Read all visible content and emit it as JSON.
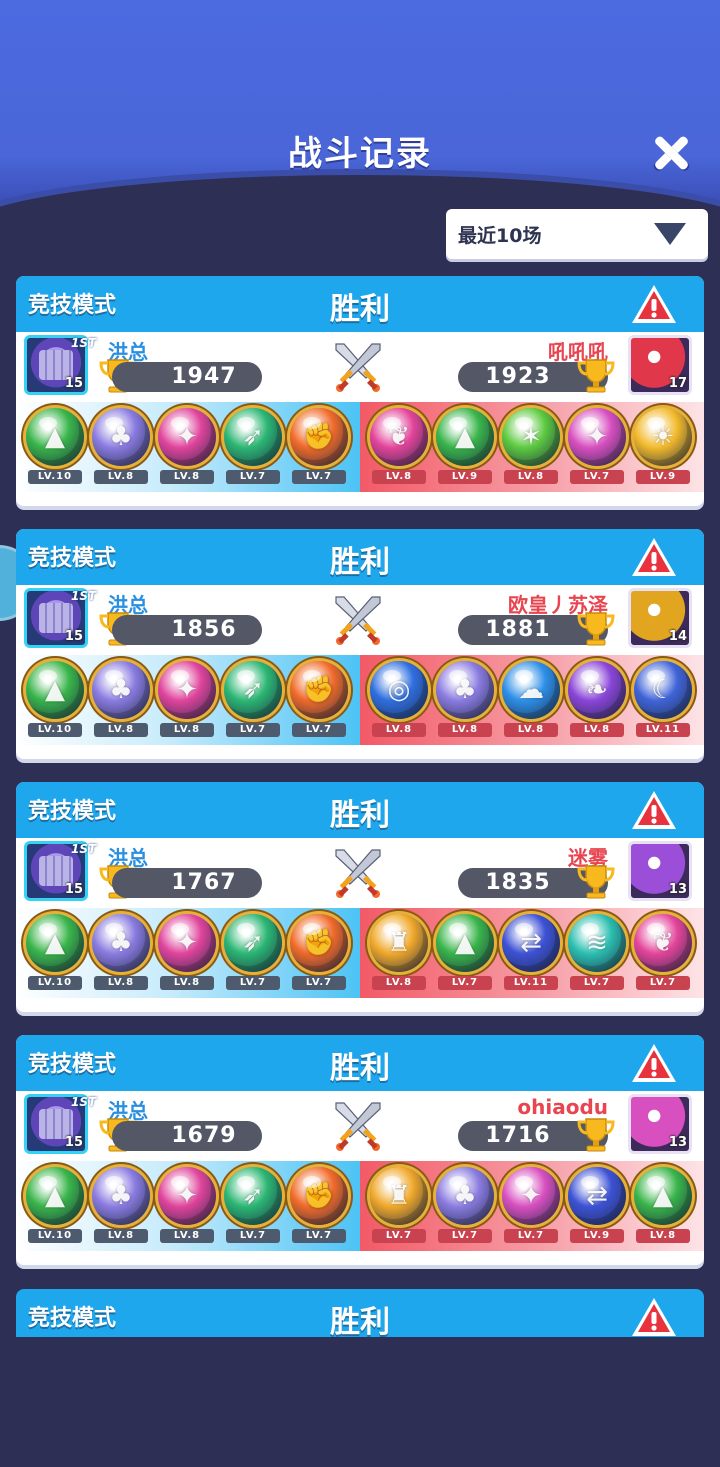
{
  "header": {
    "title": "战斗记录"
  },
  "filter": {
    "label": "最近10场"
  },
  "colors": {
    "accent": "#1ea7ec",
    "win_text": "#ffffff",
    "me_name": "#2a8fe0",
    "opp_name": "#e84550"
  },
  "me": {
    "name": "洪总",
    "level": "15",
    "rank_badge": "1ST"
  },
  "records": [
    {
      "mode": "竞技模式",
      "result": "胜利",
      "me_score": "1947",
      "opp": {
        "name": "吼吼吼",
        "score": "1923",
        "level": "17",
        "avatar_color": "#e0384a"
      },
      "me_orbs": [
        {
          "icon": "arrow-up-icon",
          "lv": "LV.10",
          "color": "#39b54a"
        },
        {
          "icon": "crowd-icon",
          "lv": "LV.8",
          "color": "#8a7be0"
        },
        {
          "icon": "phoenix-icon",
          "lv": "LV.8",
          "color": "#e0449c"
        },
        {
          "icon": "bow-icon",
          "lv": "LV.7",
          "color": "#2bb673"
        },
        {
          "icon": "fist-icon",
          "lv": "LV.7",
          "color": "#f26b2a"
        }
      ],
      "opp_orbs": [
        {
          "icon": "feather-icon",
          "lv": "LV.8",
          "color": "#e4449a"
        },
        {
          "icon": "arrow-up-icon",
          "lv": "LV.9",
          "color": "#39b54a"
        },
        {
          "icon": "star-icon",
          "lv": "LV.8",
          "color": "#5cc93f"
        },
        {
          "icon": "phoenix-icon",
          "lv": "LV.7",
          "color": "#d84fc0"
        },
        {
          "icon": "sun-icon",
          "lv": "LV.9",
          "color": "#f2b92a"
        }
      ]
    },
    {
      "mode": "竞技模式",
      "result": "胜利",
      "me_score": "1856",
      "opp": {
        "name": "欧皇丿苏泽",
        "score": "1881",
        "level": "14",
        "avatar_color": "#e2a51f"
      },
      "me_orbs": [
        {
          "icon": "arrow-up-icon",
          "lv": "LV.10",
          "color": "#39b54a"
        },
        {
          "icon": "crowd-icon",
          "lv": "LV.8",
          "color": "#8a7be0"
        },
        {
          "icon": "phoenix-icon",
          "lv": "LV.8",
          "color": "#e0449c"
        },
        {
          "icon": "bow-icon",
          "lv": "LV.7",
          "color": "#2bb673"
        },
        {
          "icon": "fist-icon",
          "lv": "LV.7",
          "color": "#f26b2a"
        }
      ],
      "opp_orbs": [
        {
          "icon": "vortex-icon",
          "lv": "LV.8",
          "color": "#2f6fe0"
        },
        {
          "icon": "crowd-icon",
          "lv": "LV.8",
          "color": "#8a7be0"
        },
        {
          "icon": "cloud-icon",
          "lv": "LV.8",
          "color": "#2d8fe8"
        },
        {
          "icon": "butterfly-icon",
          "lv": "LV.8",
          "color": "#8a45d8"
        },
        {
          "icon": "moon-icon",
          "lv": "LV.11",
          "color": "#4064d8"
        }
      ]
    },
    {
      "mode": "竞技模式",
      "result": "胜利",
      "me_score": "1767",
      "opp": {
        "name": "迷雾",
        "score": "1835",
        "level": "13",
        "avatar_color": "#9b4fd8"
      },
      "me_orbs": [
        {
          "icon": "arrow-up-icon",
          "lv": "LV.10",
          "color": "#39b54a"
        },
        {
          "icon": "crowd-icon",
          "lv": "LV.8",
          "color": "#8a7be0"
        },
        {
          "icon": "phoenix-icon",
          "lv": "LV.8",
          "color": "#e0449c"
        },
        {
          "icon": "bow-icon",
          "lv": "LV.7",
          "color": "#2bb673"
        },
        {
          "icon": "fist-icon",
          "lv": "LV.7",
          "color": "#f26b2a"
        }
      ],
      "opp_orbs": [
        {
          "icon": "helmet-icon",
          "lv": "LV.8",
          "color": "#f0a82a"
        },
        {
          "icon": "arrow-up-icon",
          "lv": "LV.7",
          "color": "#39b54a"
        },
        {
          "icon": "swap-icon",
          "lv": "LV.11",
          "color": "#3d52d6"
        },
        {
          "icon": "tornado-icon",
          "lv": "LV.7",
          "color": "#2bbfb0"
        },
        {
          "icon": "feather-icon",
          "lv": "LV.7",
          "color": "#e4449a"
        }
      ]
    },
    {
      "mode": "竞技模式",
      "result": "胜利",
      "me_score": "1679",
      "opp": {
        "name": "ohiaodu",
        "score": "1716",
        "level": "13",
        "avatar_color": "#d84fc0"
      },
      "me_orbs": [
        {
          "icon": "arrow-up-icon",
          "lv": "LV.10",
          "color": "#39b54a"
        },
        {
          "icon": "crowd-icon",
          "lv": "LV.8",
          "color": "#8a7be0"
        },
        {
          "icon": "phoenix-icon",
          "lv": "LV.8",
          "color": "#e0449c"
        },
        {
          "icon": "bow-icon",
          "lv": "LV.7",
          "color": "#2bb673"
        },
        {
          "icon": "fist-icon",
          "lv": "LV.7",
          "color": "#f26b2a"
        }
      ],
      "opp_orbs": [
        {
          "icon": "helmet-icon",
          "lv": "LV.7",
          "color": "#f0a82a"
        },
        {
          "icon": "crowd-icon",
          "lv": "LV.7",
          "color": "#8a7be0"
        },
        {
          "icon": "phoenix-icon",
          "lv": "LV.7",
          "color": "#d84fc0"
        },
        {
          "icon": "swap-icon",
          "lv": "LV.9",
          "color": "#3d52d6"
        },
        {
          "icon": "arrow-up-icon",
          "lv": "LV.8",
          "color": "#39b54a"
        }
      ]
    }
  ],
  "partial_record": {
    "mode": "竞技模式",
    "result": "胜利"
  }
}
